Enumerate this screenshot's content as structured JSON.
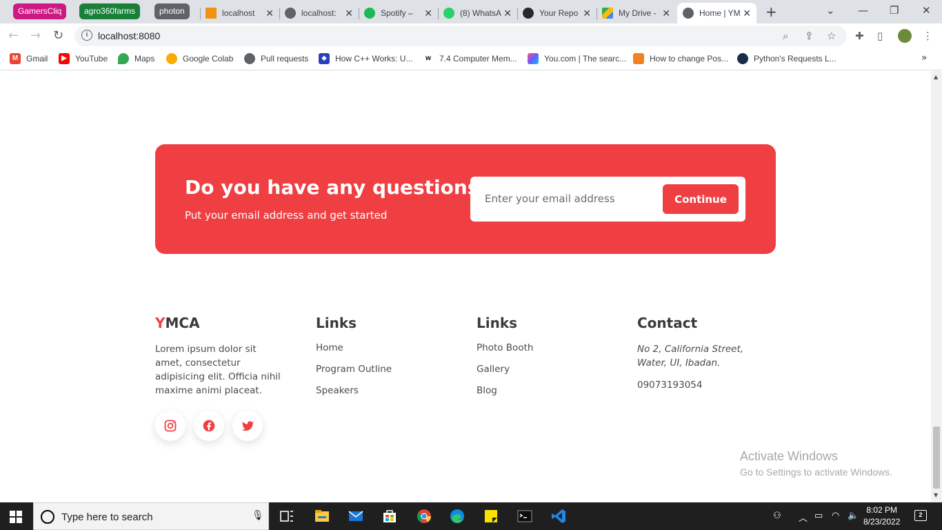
{
  "browser": {
    "tab_groups": [
      "GamersCliq",
      "agro360farms",
      "photon"
    ],
    "tabs": [
      {
        "title": "localhost",
        "icon": "phpmyadmin-icon"
      },
      {
        "title": "localhost:",
        "icon": "globe-icon"
      },
      {
        "title": "Spotify – ",
        "icon": "spotify-icon"
      },
      {
        "title": "(8) WhatsA",
        "icon": "whatsapp-icon"
      },
      {
        "title": "Your Repo",
        "icon": "github-icon"
      },
      {
        "title": "My Drive -",
        "icon": "google-drive-icon"
      },
      {
        "title": "Home | YM",
        "icon": "globe-icon",
        "active": true
      }
    ],
    "url": "localhost:8080",
    "bookmarks": [
      {
        "label": "Gmail",
        "icon": "gmail-icon"
      },
      {
        "label": "YouTube",
        "icon": "youtube-icon"
      },
      {
        "label": "Maps",
        "icon": "maps-icon"
      },
      {
        "label": "Google Colab",
        "icon": "colab-icon"
      },
      {
        "label": "Pull requests",
        "icon": "globe-icon"
      },
      {
        "label": "How C++ Works: U...",
        "icon": "bookmark-icon"
      },
      {
        "label": "7.4 Computer Mem...",
        "icon": "w-icon"
      },
      {
        "label": "You.com | The searc...",
        "icon": "youcom-icon"
      },
      {
        "label": "How to change Pos...",
        "icon": "stackoverflow-icon"
      },
      {
        "label": "Python's Requests L...",
        "icon": "realpython-icon"
      }
    ]
  },
  "cta": {
    "heading": "Do you have any questions?",
    "subtext": "Put your email address and get started",
    "email_placeholder": "Enter your email address",
    "button_label": "Continue"
  },
  "footer": {
    "brand_first_letter": "Y",
    "brand_rest": "MCA",
    "description": "Lorem ipsum dolor sit amet, consectetur adipisicing elit. Officia nihil maxime animi placeat.",
    "links1_title": "Links",
    "links1": [
      "Home",
      "Program Outline",
      "Speakers"
    ],
    "links2_title": "Links",
    "links2": [
      "Photo Booth",
      "Gallery",
      "Blog"
    ],
    "contact_title": "Contact",
    "address": "No 2, California Street, Water, UI, Ibadan.",
    "phone": "09073193054",
    "social": [
      "instagram-icon",
      "facebook-icon",
      "twitter-icon"
    ]
  },
  "watermark": {
    "title": "Activate Windows",
    "subtitle": "Go to Settings to activate Windows."
  },
  "taskbar": {
    "search_placeholder": "Type here to search",
    "time": "8:02 PM",
    "date": "8/23/2022",
    "notification_count": "2"
  },
  "colors": {
    "accent": "#ef3f42",
    "text": "#4a4a4a"
  }
}
